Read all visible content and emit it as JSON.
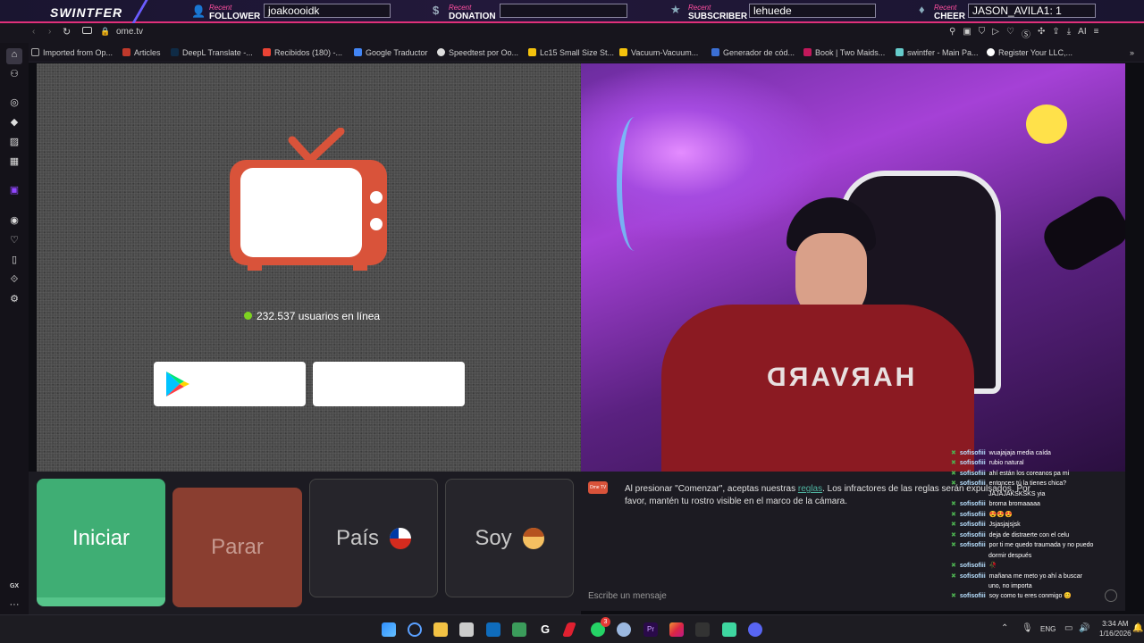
{
  "overlay": {
    "brand": "SWINTFER",
    "recent": "Recent",
    "follower_label": "FOLLOWER",
    "follower_value": "joakoooidk",
    "donation_label": "DONATION",
    "donation_value": "",
    "subscriber_label": "SUBSCRIBER",
    "subscriber_value": "lehuede",
    "cheer_label": "CHEER",
    "cheer_value": "JASON_AVILA1: 1"
  },
  "browser": {
    "url": "ome.tv",
    "bookmarks": [
      "Imported from Op...",
      "Articles",
      "DeepL Translate -...",
      "Recibidos (180) -...",
      "Google Traductor",
      "Speedtest por Oo...",
      "Lc15 Small Size St...",
      "Vacuum-Vacuum...",
      "Generador de cód...",
      "Book | Two Maids...",
      "swintfer - Main Pa...",
      "Register Your LLC,..."
    ]
  },
  "sidebar": {
    "gx_label": "GX",
    "more_label": "···"
  },
  "app": {
    "online_count": "232.537 usuarios en línea",
    "btn_start": "Iniciar",
    "btn_stop": "Parar",
    "btn_country": "País",
    "btn_gender": "Soy",
    "flag_icon": "chile-flag",
    "avatar_icon": "boy-emoji",
    "notice_pre": "Al presionar \"Comenzar\", aceptas nuestras ",
    "notice_link": "reglas",
    "notice_post": ". Los infractores de las reglas serán expulsados. Por favor, mantén tu rostro visible en el marco de la cámara.",
    "message_placeholder": "Escribe un mensaje",
    "logo_label": "Ome TV"
  },
  "stream": {
    "shirt_text": "HARVARD",
    "chat": [
      {
        "user": "sofisofiii",
        "text": "wuajajaja media caída"
      },
      {
        "user": "sofisofiii",
        "text": "rubio natural"
      },
      {
        "user": "sofisofiii",
        "text": "ahí están los coreanos pa mi"
      },
      {
        "user": "sofisofiii",
        "text": "entonces tú la tienes chica?"
      },
      {
        "user": "",
        "text": "JAJAJAKSKSKS yia"
      },
      {
        "user": "sofisofiii",
        "text": "broma bromaaaaa"
      },
      {
        "user": "sofisofiii",
        "text": "😍😍😍"
      },
      {
        "user": "sofisofiii",
        "text": "Jsjasjajsjsk"
      },
      {
        "user": "sofisofiii",
        "text": "deja de distraerte con el celu"
      },
      {
        "user": "sofisofiii",
        "text": "por ti me quedo traumada y no puedo"
      },
      {
        "user": "",
        "text": "dormir después"
      },
      {
        "user": "sofisofiii",
        "text": "🥀"
      },
      {
        "user": "sofisofiii",
        "text": "mañana me meto yo ahí a buscar"
      },
      {
        "user": "",
        "text": "uno, no importa"
      },
      {
        "user": "sofisofiii",
        "text": "soy como tu eres conmigo 😊"
      }
    ]
  },
  "taskbar": {
    "lang": "ENG",
    "time": "3:34 AM",
    "date": "1/16/2026",
    "badge": "3"
  },
  "colors": {
    "start": "#3fae74",
    "stop": "#8a3e30",
    "tv": "#d9533a",
    "accent": "#e0307a"
  }
}
